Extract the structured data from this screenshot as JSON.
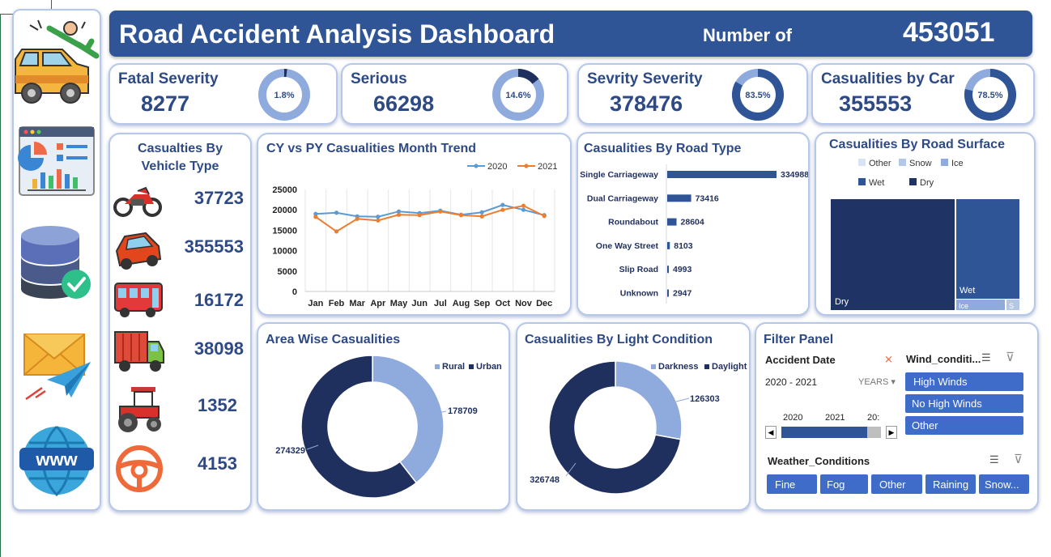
{
  "header": {
    "title": "Road Accident Analysis Dashboard",
    "count_label": "Number of",
    "count_value": "453051"
  },
  "kpis": [
    {
      "title": "Fatal Severity",
      "value": "8277",
      "pct_label": "1.8%",
      "pct": 0.018
    },
    {
      "title": "Serious",
      "value": "66298",
      "pct_label": "14.6%",
      "pct": 0.146
    },
    {
      "title": "Sevrity Severity",
      "value": "378476",
      "pct_label": "83.5%",
      "pct": 0.835
    },
    {
      "title": "Casualities by Car",
      "value": "355553",
      "pct_label": "78.5%",
      "pct": 0.785
    }
  ],
  "vehicle_type": {
    "title_line1": "Casualties By",
    "title_line2": "Vehicle Type",
    "items": [
      {
        "icon": "motorcycle-icon",
        "value": "37723"
      },
      {
        "icon": "car-icon",
        "value": "355553"
      },
      {
        "icon": "bus-icon",
        "value": "16172"
      },
      {
        "icon": "truck-icon",
        "value": "38098"
      },
      {
        "icon": "tractor-icon",
        "value": "1352"
      },
      {
        "icon": "steering-wheel-icon",
        "value": "4153"
      }
    ]
  },
  "colors": {
    "navy": "#1f2f5e",
    "blue": "#2f5597",
    "light": "#8faadc",
    "line2020": "#5b9bd5",
    "line2021": "#ed7d31"
  },
  "chart_data": [
    {
      "type": "line",
      "title": "CY vs PY Casualities Month Trend",
      "categories": [
        "Jan",
        "Feb",
        "Mar",
        "Apr",
        "May",
        "Jun",
        "Jul",
        "Aug",
        "Sep",
        "Oct",
        "Nov",
        "Dec"
      ],
      "series": [
        {
          "name": "2020",
          "values": [
            19000,
            19300,
            18400,
            18300,
            19600,
            19200,
            19800,
            18800,
            19400,
            21200,
            20000,
            18700
          ]
        },
        {
          "name": "2021",
          "values": [
            18300,
            14700,
            17800,
            17400,
            18800,
            18700,
            19600,
            18700,
            18400,
            20000,
            21000,
            18500
          ]
        }
      ],
      "yticks": [
        "0",
        "5000",
        "10000",
        "15000",
        "20000",
        "25000"
      ],
      "ylim": [
        0,
        25000
      ]
    },
    {
      "type": "bar",
      "title": "Casualities By Road Type",
      "categories": [
        "Single Carriageway",
        "Dual Carriageway",
        "Roundabout",
        "One Way Street",
        "Slip Road",
        "Unknown"
      ],
      "values": [
        334988,
        73416,
        28604,
        8103,
        4993,
        2947
      ],
      "value_labels": [
        "334988",
        "73416",
        "28604",
        "8103",
        "4993",
        "2947"
      ]
    },
    {
      "type": "treemap",
      "title": "Casualities By Road Surface",
      "legend": [
        "Other",
        "Snow",
        "Ice",
        "Wet",
        "Dry"
      ],
      "labels": {
        "dry": "Dry",
        "wet": "Wet",
        "ice": "Ice",
        "snow": "S"
      }
    },
    {
      "type": "pie",
      "title": "Area Wise Casualities",
      "categories": [
        "Rural",
        "Urban"
      ],
      "values": [
        178709,
        274329
      ],
      "value_labels": [
        "178709",
        "274329"
      ]
    },
    {
      "type": "pie",
      "title": "Casualities By Light Condition",
      "categories": [
        "Darkness",
        "Daylight"
      ],
      "values": [
        126303,
        326748
      ],
      "value_labels": [
        "126303",
        "326748"
      ]
    }
  ],
  "filter": {
    "title": "Filter Panel",
    "date_label": "Accident Date",
    "date_range": "2020 - 2021",
    "years_label": "YEARS",
    "timeline": [
      "2020",
      "2021",
      "20:"
    ],
    "wind_label": "Wind_conditi...",
    "wind_options": [
      "High Winds",
      "No High Winds",
      "Other"
    ],
    "weather_label": "Weather_Conditions",
    "weather_options": [
      "Fine",
      "Fog",
      "Other",
      "Raining",
      "Snow..."
    ]
  }
}
